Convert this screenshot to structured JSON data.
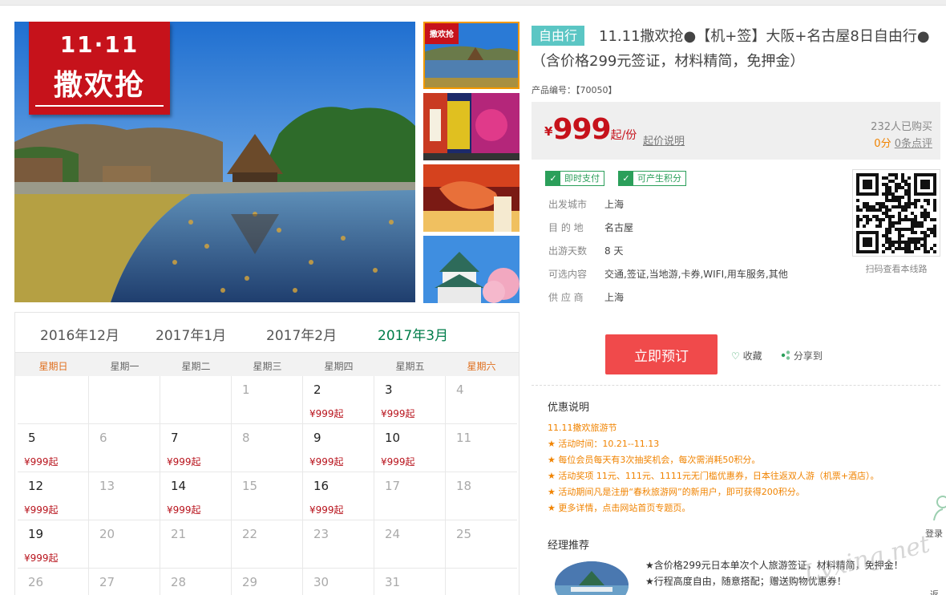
{
  "promo_badge": {
    "top": "11·11",
    "main": "撒欢抢"
  },
  "product": {
    "tag": "自由行",
    "title": "11.11撒欢抢●【机+签】大阪+名古屋8日自由行●（含价格299元签证，材料精简，免押金）",
    "code_label": "产品编号：",
    "code_value": "【70050】"
  },
  "price": {
    "currency": "¥",
    "amount": "999",
    "unit": "起/份",
    "note_link": "起价说明",
    "bought": "232人已购买",
    "score": "0分",
    "reviews_link": "0条点评"
  },
  "badges": [
    "即时支付",
    "可产生积分"
  ],
  "info": [
    {
      "label": "出发城市",
      "value": "上海"
    },
    {
      "label": "目 的 地",
      "value": "名古屋"
    },
    {
      "label": "出游天数",
      "value": "8 天"
    },
    {
      "label": "可选内容",
      "value": "交通,签证,当地游,卡券,WIFI,用车服务,其他"
    },
    {
      "label": "供 应 商",
      "value": "上海"
    }
  ],
  "qr_caption": "扫码查看本线路",
  "actions": {
    "book": "立即预订",
    "favorite": "收藏",
    "share": "分享到"
  },
  "calendar": {
    "months": [
      "2016年12月",
      "2017年1月",
      "2017年2月",
      "2017年3月"
    ],
    "active_month": 3,
    "weekdays": [
      "星期日",
      "星期一",
      "星期二",
      "星期三",
      "星期四",
      "星期五",
      "星期六"
    ],
    "days": [
      {
        "d": "",
        "p": ""
      },
      {
        "d": "",
        "p": ""
      },
      {
        "d": "",
        "p": ""
      },
      {
        "d": "1",
        "p": "",
        "dim": true
      },
      {
        "d": "2",
        "p": "¥999起"
      },
      {
        "d": "3",
        "p": "¥999起"
      },
      {
        "d": "4",
        "p": "",
        "dim": true
      },
      {
        "d": "5",
        "p": "¥999起"
      },
      {
        "d": "6",
        "p": "",
        "dim": true
      },
      {
        "d": "7",
        "p": "¥999起"
      },
      {
        "d": "8",
        "p": "",
        "dim": true
      },
      {
        "d": "9",
        "p": "¥999起"
      },
      {
        "d": "10",
        "p": "¥999起"
      },
      {
        "d": "11",
        "p": "",
        "dim": true
      },
      {
        "d": "12",
        "p": "¥999起"
      },
      {
        "d": "13",
        "p": "",
        "dim": true
      },
      {
        "d": "14",
        "p": "¥999起"
      },
      {
        "d": "15",
        "p": "",
        "dim": true
      },
      {
        "d": "16",
        "p": "¥999起"
      },
      {
        "d": "17",
        "p": "",
        "dim": true
      },
      {
        "d": "18",
        "p": "",
        "dim": true
      },
      {
        "d": "19",
        "p": "¥999起"
      },
      {
        "d": "20",
        "p": "",
        "dim": true
      },
      {
        "d": "21",
        "p": "",
        "dim": true
      },
      {
        "d": "22",
        "p": "",
        "dim": true
      },
      {
        "d": "23",
        "p": "",
        "dim": true
      },
      {
        "d": "24",
        "p": "",
        "dim": true
      },
      {
        "d": "25",
        "p": "",
        "dim": true
      },
      {
        "d": "26",
        "p": "",
        "dim": true
      },
      {
        "d": "27",
        "p": "",
        "dim": true
      },
      {
        "d": "28",
        "p": "",
        "dim": true
      },
      {
        "d": "29",
        "p": "",
        "dim": true
      },
      {
        "d": "30",
        "p": "",
        "dim": true
      },
      {
        "d": "31",
        "p": "",
        "dim": true
      },
      {
        "d": "",
        "p": ""
      }
    ]
  },
  "promo_section": {
    "title": "优惠说明",
    "items": [
      "11.11撒欢旅游节",
      "★ 活动时间：10.21--11.13",
      "★ 每位会员每天有3次抽奖机会，每次需消耗50积分。",
      "★ 活动奖项 11元、111元、1111元无门槛优惠券，日本往返双人游（机票+酒店）。",
      "★ 活动期间凡是注册“春秋旅游网”的新用户，即可获得200积分。",
      "★ 更多详情，点击网站首页专题页。"
    ]
  },
  "manager": {
    "title": "经理推荐",
    "items": [
      "★含价格299元日本单次个人旅游签证，材料精简，免押金！",
      "★行程高度自由，随意搭配；赠送购物优惠券！"
    ]
  },
  "sidebar": {
    "login": "登录",
    "back": "返回"
  },
  "watermark": "Lvxing.net",
  "colors": {
    "accent_red": "#c6121b",
    "green": "#2b9f5a",
    "orange": "#f08300",
    "teal_tag": "#5bc6c4",
    "button_red": "#f04a4b"
  }
}
